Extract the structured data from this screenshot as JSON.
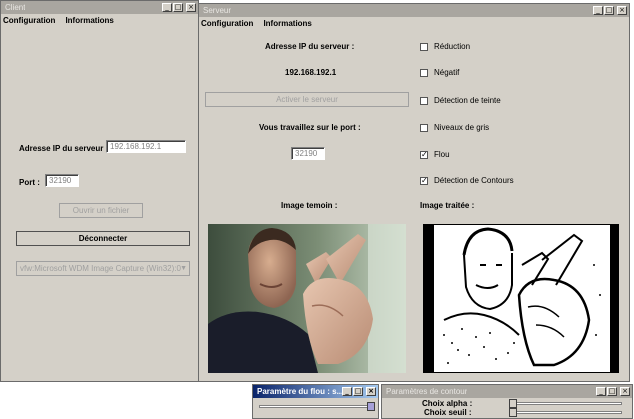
{
  "client": {
    "title": "Client",
    "menu": [
      "Configuration",
      "Informations"
    ],
    "ip_label": "Adresse IP du serveur :",
    "ip_value": "192.168.192.1",
    "port_label": "Port :",
    "port_value": "32190",
    "open_file_button": "Ouvrir un fichier",
    "disconnect_button": "Déconnecter",
    "capture_device": "vfw:Microsoft WDM Image Capture (Win32):0"
  },
  "server": {
    "title": "Serveur",
    "menu": [
      "Configuration",
      "Informations"
    ],
    "ip_label": "Adresse IP du serveur :",
    "ip_value": "192.168.192.1",
    "activate_button": "Activer le serveur",
    "port_label": "Vous travaillez sur le port :",
    "port_value": "32190",
    "sample_image_label": "Image temoin :",
    "processed_image_label": "Image traitée :",
    "filters": [
      {
        "label": "Réduction",
        "checked": false
      },
      {
        "label": "Négatif",
        "checked": false
      },
      {
        "label": "Détection de teinte",
        "checked": false
      },
      {
        "label": "Niveaux de gris",
        "checked": false
      },
      {
        "label": "Flou",
        "checked": true
      },
      {
        "label": "Détection de Contours",
        "checked": true
      }
    ]
  },
  "blur_params": {
    "title": "Paramètre du flou : s...",
    "slider_value": 1.0
  },
  "contour_params": {
    "title": "Paramètres de contour",
    "alpha_label": "Choix alpha :",
    "threshold_label": "Choix seuil :",
    "alpha_value": 0.0,
    "threshold_value": 0.0
  },
  "window_buttons": [
    "_",
    "□",
    "×"
  ],
  "check_mark": "✓",
  "arrow_down": "▼",
  "colors": {
    "window_bg": "#d4d0c8",
    "active_title": "#0a246a",
    "inactive_title": "#a9a6a0"
  }
}
